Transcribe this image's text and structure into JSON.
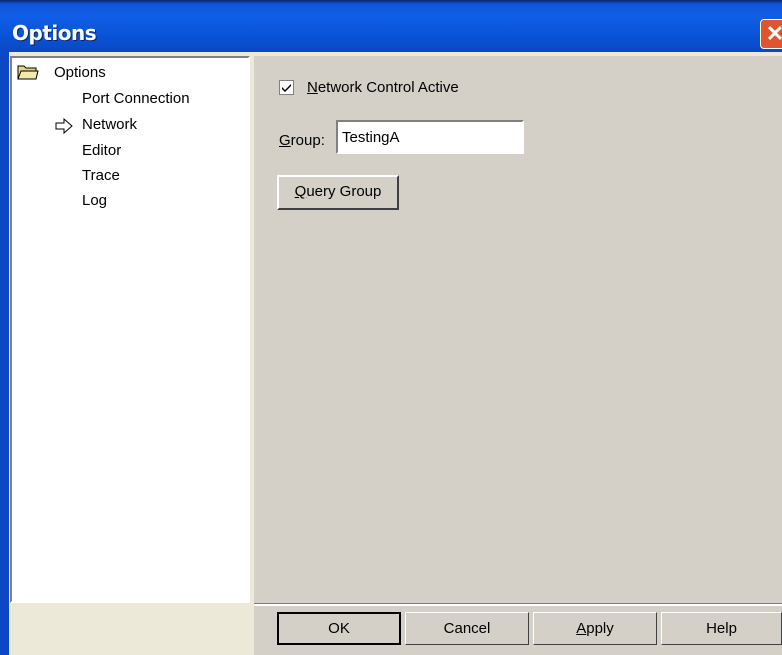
{
  "window": {
    "title": "Options",
    "close_glyph": "✕"
  },
  "tree": {
    "root": "Options",
    "items": [
      "Port Connection",
      "Network",
      "Editor",
      "Trace",
      "Log"
    ],
    "selected": "Network"
  },
  "network": {
    "checkbox_label_u": "N",
    "checkbox_label_rest": "etwork Control Active",
    "checked": true,
    "group_label_u": "G",
    "group_label_rest": "roup:",
    "group_value": "TestingA",
    "query_label_u": "Q",
    "query_label_rest": "uery Group"
  },
  "buttons": {
    "ok": "OK",
    "cancel": "Cancel",
    "apply_u": "A",
    "apply_rest": "pply",
    "help": "Help"
  },
  "icons": [
    "folder-icon",
    "arrow-right-icon",
    "close-icon",
    "checkmark-icon"
  ]
}
